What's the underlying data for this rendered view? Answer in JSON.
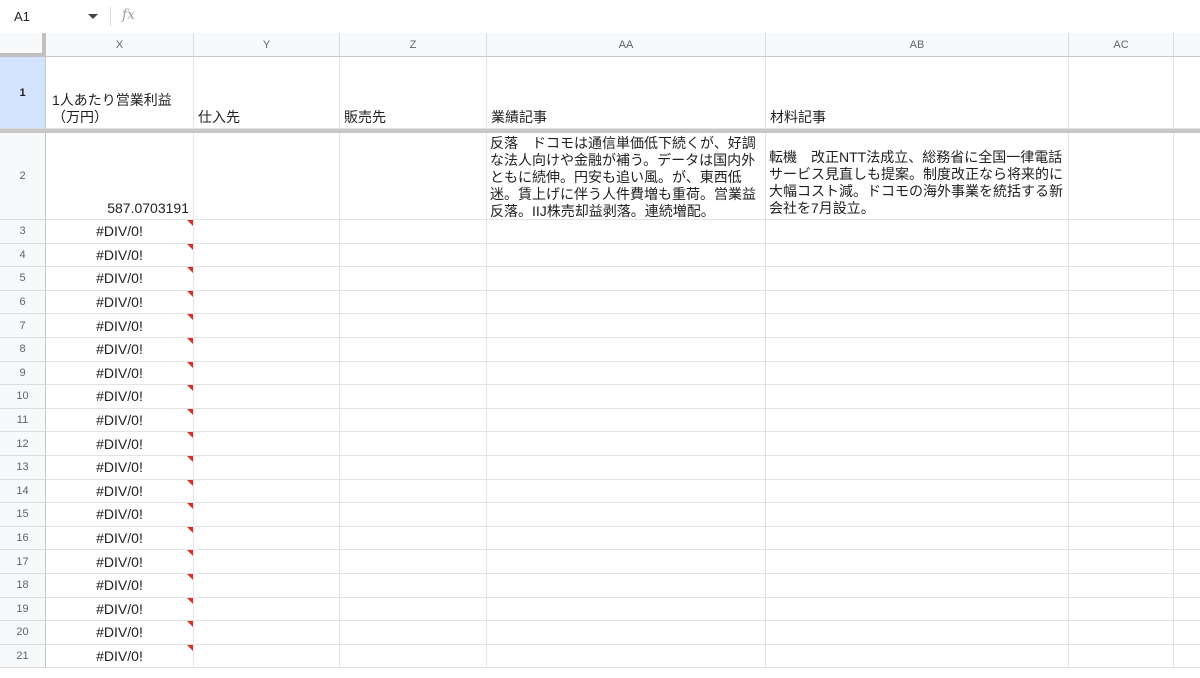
{
  "formula_bar": {
    "name_box": "A1",
    "fx_label": "fx",
    "formula": ""
  },
  "columns": [
    "X",
    "Y",
    "Z",
    "AA",
    "AB",
    "AC"
  ],
  "header_row": {
    "row_number": "1",
    "x": "1人あたり営業利益（万円）",
    "y": "仕入先",
    "z": "販売先",
    "aa": "業績記事",
    "ab": "材料記事",
    "ac": ""
  },
  "row2": {
    "row_number": "2",
    "x": "587.0703191",
    "aa": "反落　ドコモは通信単価低下続くが、好調な法人向けや金融が補う。データは国内外ともに続伸。円安も追い風。が、東西低迷。賃上げに伴う人件費増も重荷。営業益反落。IIJ株売却益剥落。連続増配。",
    "ab": "転機　改正NTT法成立、総務省に全国一律電話サービス見直しも提案。制度改正なら将来的に大幅コスト減。ドコモの海外事業を統括する新会社を7月設立。"
  },
  "error_rows": [
    {
      "row_number": "3",
      "x": "#DIV/0!"
    },
    {
      "row_number": "4",
      "x": "#DIV/0!"
    },
    {
      "row_number": "5",
      "x": "#DIV/0!"
    },
    {
      "row_number": "6",
      "x": "#DIV/0!"
    },
    {
      "row_number": "7",
      "x": "#DIV/0!"
    },
    {
      "row_number": "8",
      "x": "#DIV/0!"
    },
    {
      "row_number": "9",
      "x": "#DIV/0!"
    },
    {
      "row_number": "10",
      "x": "#DIV/0!"
    },
    {
      "row_number": "11",
      "x": "#DIV/0!"
    },
    {
      "row_number": "12",
      "x": "#DIV/0!"
    },
    {
      "row_number": "13",
      "x": "#DIV/0!"
    },
    {
      "row_number": "14",
      "x": "#DIV/0!"
    },
    {
      "row_number": "15",
      "x": "#DIV/0!"
    },
    {
      "row_number": "16",
      "x": "#DIV/0!"
    },
    {
      "row_number": "17",
      "x": "#DIV/0!"
    },
    {
      "row_number": "18",
      "x": "#DIV/0!"
    },
    {
      "row_number": "19",
      "x": "#DIV/0!"
    },
    {
      "row_number": "20",
      "x": "#DIV/0!"
    },
    {
      "row_number": "21",
      "x": "#DIV/0!"
    }
  ],
  "colors": {
    "error_marker": "#d93025",
    "selected_row_header": "#d3e3fd"
  }
}
